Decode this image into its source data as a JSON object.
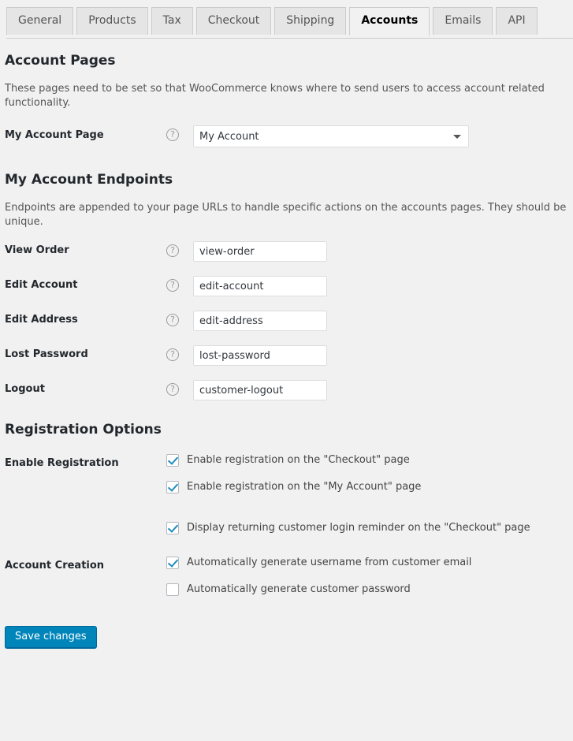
{
  "tabs": [
    {
      "label": "General",
      "active": false
    },
    {
      "label": "Products",
      "active": false
    },
    {
      "label": "Tax",
      "active": false
    },
    {
      "label": "Checkout",
      "active": false
    },
    {
      "label": "Shipping",
      "active": false
    },
    {
      "label": "Accounts",
      "active": true
    },
    {
      "label": "Emails",
      "active": false
    },
    {
      "label": "API",
      "active": false
    }
  ],
  "account_pages": {
    "title": "Account Pages",
    "description": "These pages need to be set so that WooCommerce knows where to send users to access account related functionality.",
    "my_account_page": {
      "label": "My Account Page",
      "help": "?",
      "value": "My Account"
    }
  },
  "endpoints": {
    "title": "My Account Endpoints",
    "description": "Endpoints are appended to your page URLs to handle specific actions on the accounts pages. They should be unique.",
    "help": "?",
    "rows": [
      {
        "label": "View Order",
        "value": "view-order"
      },
      {
        "label": "Edit Account",
        "value": "edit-account"
      },
      {
        "label": "Edit Address",
        "value": "edit-address"
      },
      {
        "label": "Lost Password",
        "value": "lost-password"
      },
      {
        "label": "Logout",
        "value": "customer-logout"
      }
    ]
  },
  "registration": {
    "title": "Registration Options",
    "enable_registration": {
      "label": "Enable Registration",
      "options": [
        {
          "label": "Enable registration on the \"Checkout\" page",
          "checked": true,
          "gap": false
        },
        {
          "label": "Enable registration on the \"My Account\" page",
          "checked": true,
          "gap": false
        },
        {
          "label": "Display returning customer login reminder on the \"Checkout\" page",
          "checked": true,
          "gap": true
        }
      ]
    },
    "account_creation": {
      "label": "Account Creation",
      "options": [
        {
          "label": "Automatically generate username from customer email",
          "checked": true,
          "gap": false
        },
        {
          "label": "Automatically generate customer password",
          "checked": false,
          "gap": false
        }
      ]
    }
  },
  "submit": {
    "label": "Save changes"
  },
  "colors": {
    "page_background": "#f1f1f1",
    "accent": "#0085ba",
    "checkbox_check": "#1e8cbe",
    "heading_text": "#23282d",
    "body_text": "#444444"
  }
}
